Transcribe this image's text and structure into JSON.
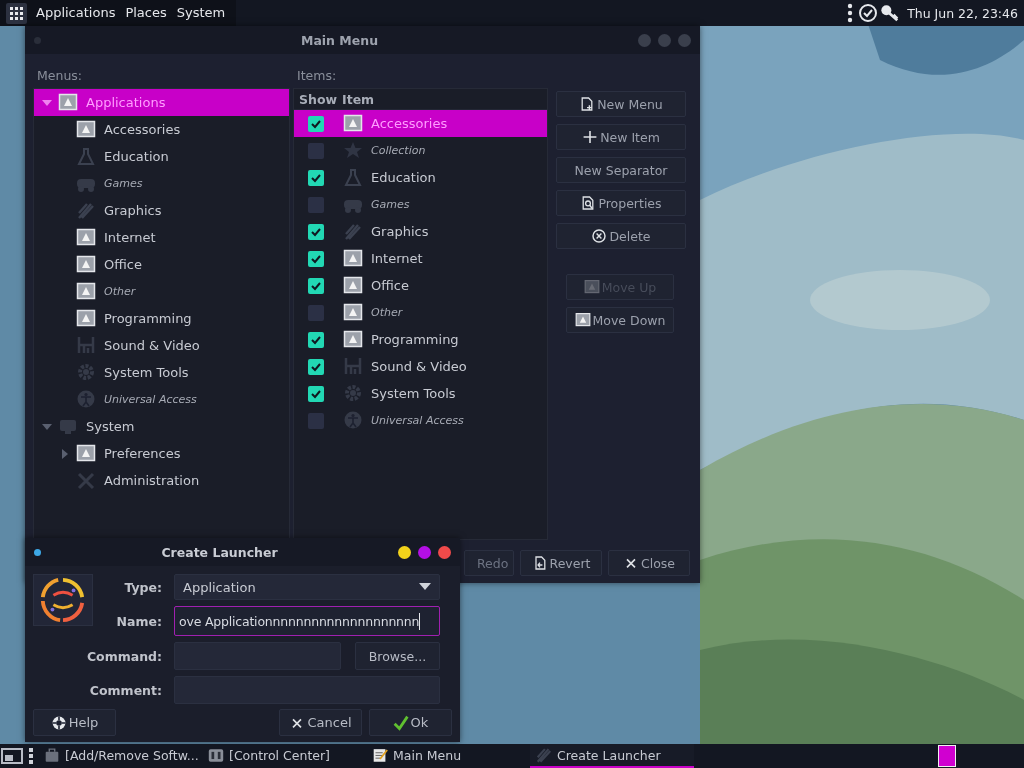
{
  "top_panel": {
    "menus": [
      "Applications",
      "Places",
      "System"
    ],
    "clock": "Thu Jun 22, 23:46"
  },
  "main_menu": {
    "title": "Main Menu",
    "menus_label": "Menus:",
    "items_label": "Items:",
    "menu_tree": [
      {
        "label": "Applications",
        "kind": "generic",
        "hidden": false,
        "selected": true,
        "expanded": true,
        "children": [
          {
            "label": "Accessories",
            "kind": "generic",
            "hidden": false,
            "selected": false
          },
          {
            "label": "Education",
            "kind": "flask",
            "hidden": false,
            "selected": false
          },
          {
            "label": "Games",
            "kind": "gamepad",
            "hidden": true,
            "selected": false
          },
          {
            "label": "Graphics",
            "kind": "brush",
            "hidden": false,
            "selected": false
          },
          {
            "label": "Internet",
            "kind": "generic",
            "hidden": false,
            "selected": false
          },
          {
            "label": "Office",
            "kind": "generic",
            "hidden": false,
            "selected": false
          },
          {
            "label": "Other",
            "kind": "generic",
            "hidden": true,
            "selected": false
          },
          {
            "label": "Programming",
            "kind": "generic",
            "hidden": false,
            "selected": false
          },
          {
            "label": "Sound & Video",
            "kind": "sound",
            "hidden": false,
            "selected": false
          },
          {
            "label": "System Tools",
            "kind": "gear",
            "hidden": false,
            "selected": false
          },
          {
            "label": "Universal Access",
            "kind": "person",
            "hidden": true,
            "selected": false
          }
        ]
      },
      {
        "label": "System",
        "kind": "monitor",
        "hidden": false,
        "selected": false,
        "expanded": true,
        "children": [
          {
            "label": "Preferences",
            "kind": "generic",
            "hidden": false,
            "selected": false,
            "expanded": false
          },
          {
            "label": "Administration",
            "kind": "tools",
            "hidden": false,
            "selected": false
          }
        ]
      }
    ],
    "items_table": {
      "columns": [
        "Show",
        "Item"
      ],
      "rows": [
        {
          "label": "Accessories",
          "kind": "generic",
          "checked": true,
          "hidden": false,
          "selected": true
        },
        {
          "label": "Collection",
          "kind": "star",
          "checked": false,
          "hidden": true,
          "selected": false
        },
        {
          "label": "Education",
          "kind": "flask",
          "checked": true,
          "hidden": false,
          "selected": false
        },
        {
          "label": "Games",
          "kind": "gamepad",
          "checked": false,
          "hidden": true,
          "selected": false
        },
        {
          "label": "Graphics",
          "kind": "brush",
          "checked": true,
          "hidden": false,
          "selected": false
        },
        {
          "label": "Internet",
          "kind": "generic",
          "checked": true,
          "hidden": false,
          "selected": false
        },
        {
          "label": "Office",
          "kind": "generic",
          "checked": true,
          "hidden": false,
          "selected": false
        },
        {
          "label": "Other",
          "kind": "generic",
          "checked": false,
          "hidden": true,
          "selected": false
        },
        {
          "label": "Programming",
          "kind": "generic",
          "checked": true,
          "hidden": false,
          "selected": false
        },
        {
          "label": "Sound & Video",
          "kind": "sound",
          "checked": true,
          "hidden": false,
          "selected": false
        },
        {
          "label": "System Tools",
          "kind": "gear",
          "checked": true,
          "hidden": false,
          "selected": false
        },
        {
          "label": "Universal Access",
          "kind": "person",
          "checked": false,
          "hidden": true,
          "selected": false
        }
      ]
    },
    "side_buttons": [
      {
        "label": "New Menu",
        "kind": "newdoc",
        "disabled": false
      },
      {
        "label": "New Item",
        "kind": "plus",
        "disabled": false
      },
      {
        "label": "New Separator",
        "kind": "text",
        "disabled": false
      },
      {
        "label": "Properties",
        "kind": "props",
        "disabled": false
      },
      {
        "label": "Delete",
        "kind": "delete",
        "disabled": false
      },
      {
        "label": "Move Up",
        "kind": "generic",
        "disabled": true
      },
      {
        "label": "Move Down",
        "kind": "generic",
        "disabled": false
      }
    ],
    "bottom_buttons": [
      {
        "label": "Redo",
        "kind": "text",
        "disabled": true
      },
      {
        "label": "Revert",
        "kind": "revert",
        "disabled": false
      },
      {
        "label": "Close",
        "kind": "x",
        "disabled": false
      }
    ]
  },
  "create_launcher": {
    "title": "Create Launcher",
    "type_label": "Type:",
    "type_value": "Application",
    "name_label": "Name:",
    "name_value": "ove Applicationnnnnnnnnnnnnnnnnnnn",
    "name_focused": true,
    "command_label": "Command:",
    "browse": "Browse...",
    "comment_label": "Comment:",
    "help": "Help",
    "cancel": "Cancel",
    "ok": "Ok"
  },
  "taskbar": {
    "items": [
      {
        "label": "[Add/Remove Softw...",
        "kind": "bag",
        "selected": false
      },
      {
        "label": "[Control Center]",
        "kind": "panel",
        "selected": false
      },
      {
        "label": "Main Menu",
        "kind": "notepad",
        "selected": false
      },
      {
        "label": "Create Launcher",
        "kind": "brush",
        "selected": true
      }
    ]
  }
}
